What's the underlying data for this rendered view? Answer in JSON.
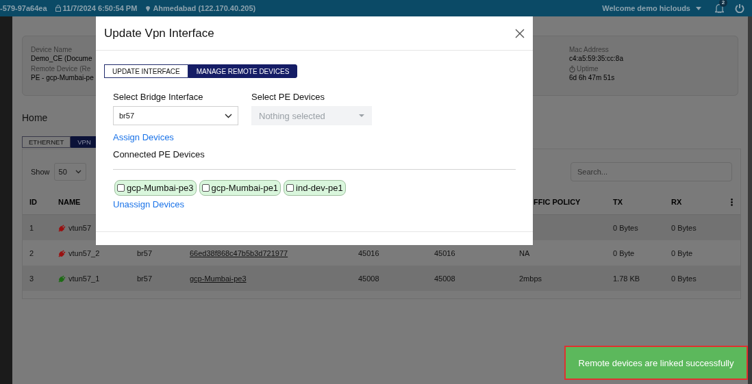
{
  "top_bar": {
    "device_id": "-579-97a64ea",
    "login_time": "11/7/2024 6:50:54 PM",
    "location": "Ahmedabad (122.170.40.205)",
    "user": "Welcome demo hiclouds",
    "notification_count": "2"
  },
  "device_card": {
    "left": [
      {
        "label": "Device Name",
        "value": "Demo_CE (Docume"
      },
      {
        "label": "Remote Device (Re",
        "value": "PE - gcp-Mumbai-pe"
      }
    ],
    "right": [
      {
        "label": "Mac Address",
        "value": "c4:a5:59:35:cc:8a",
        "kind": "plain"
      },
      {
        "label": "Uptime",
        "value": "6d 6h 47m 51s",
        "kind": "timer"
      }
    ]
  },
  "breadcrumb": "Home",
  "tabs": [
    {
      "label": "ETHERNET",
      "selected": false
    },
    {
      "label": "VPN",
      "selected": true
    }
  ],
  "table": {
    "show_label": "Show",
    "page_size": "50",
    "search_placeholder": "Search...",
    "columns": [
      "ID",
      "NAME",
      "FFIC POLICY",
      "TX",
      "RX"
    ],
    "rows": [
      {
        "id": "1",
        "name": "vtun57",
        "connected": false,
        "tx": "0 Bytes",
        "rx": "0 Bytes"
      },
      {
        "id": "2",
        "name": "vtun57_2",
        "connected": false,
        "bridge": "br57",
        "remote": "66ed38f868c47b5b3d721977",
        "port_1": "45016",
        "port_2": "45016",
        "policy": "NA",
        "tx": "0 Byte",
        "rx": "0 Byte"
      },
      {
        "id": "3",
        "name": "vtun57_1",
        "connected": true,
        "bridge": "br57",
        "remote": "gcp-Mumbai-pe3",
        "port_1": "45008",
        "port_2": "45008",
        "policy": "2mbps",
        "tx": "1.78 KB",
        "rx": "0 Bytes"
      }
    ]
  },
  "modal": {
    "title": "Update Vpn Interface",
    "tabs": [
      {
        "label": "UPDATE INTERFACE",
        "selected": false
      },
      {
        "label": "MANAGE REMOTE DEVICES",
        "selected": true
      }
    ],
    "bridge_label": "Select Bridge Interface",
    "bridge_value": "br57",
    "pe_label": "Select PE Devices",
    "pe_placeholder": "Nothing selected",
    "pe_disabled": true,
    "assign_link": "Assign Devices",
    "connected_label": "Connected PE Devices",
    "devices": [
      {
        "name": "gcp-Mumbai-pe3",
        "checked": false
      },
      {
        "name": "gcp-Mumbai-pe1",
        "checked": false
      },
      {
        "name": "ind-dev-pe1",
        "checked": false
      }
    ],
    "unassign_link": "Unassign Devices"
  },
  "toast": {
    "message": "Remote devices are linked successfully"
  }
}
